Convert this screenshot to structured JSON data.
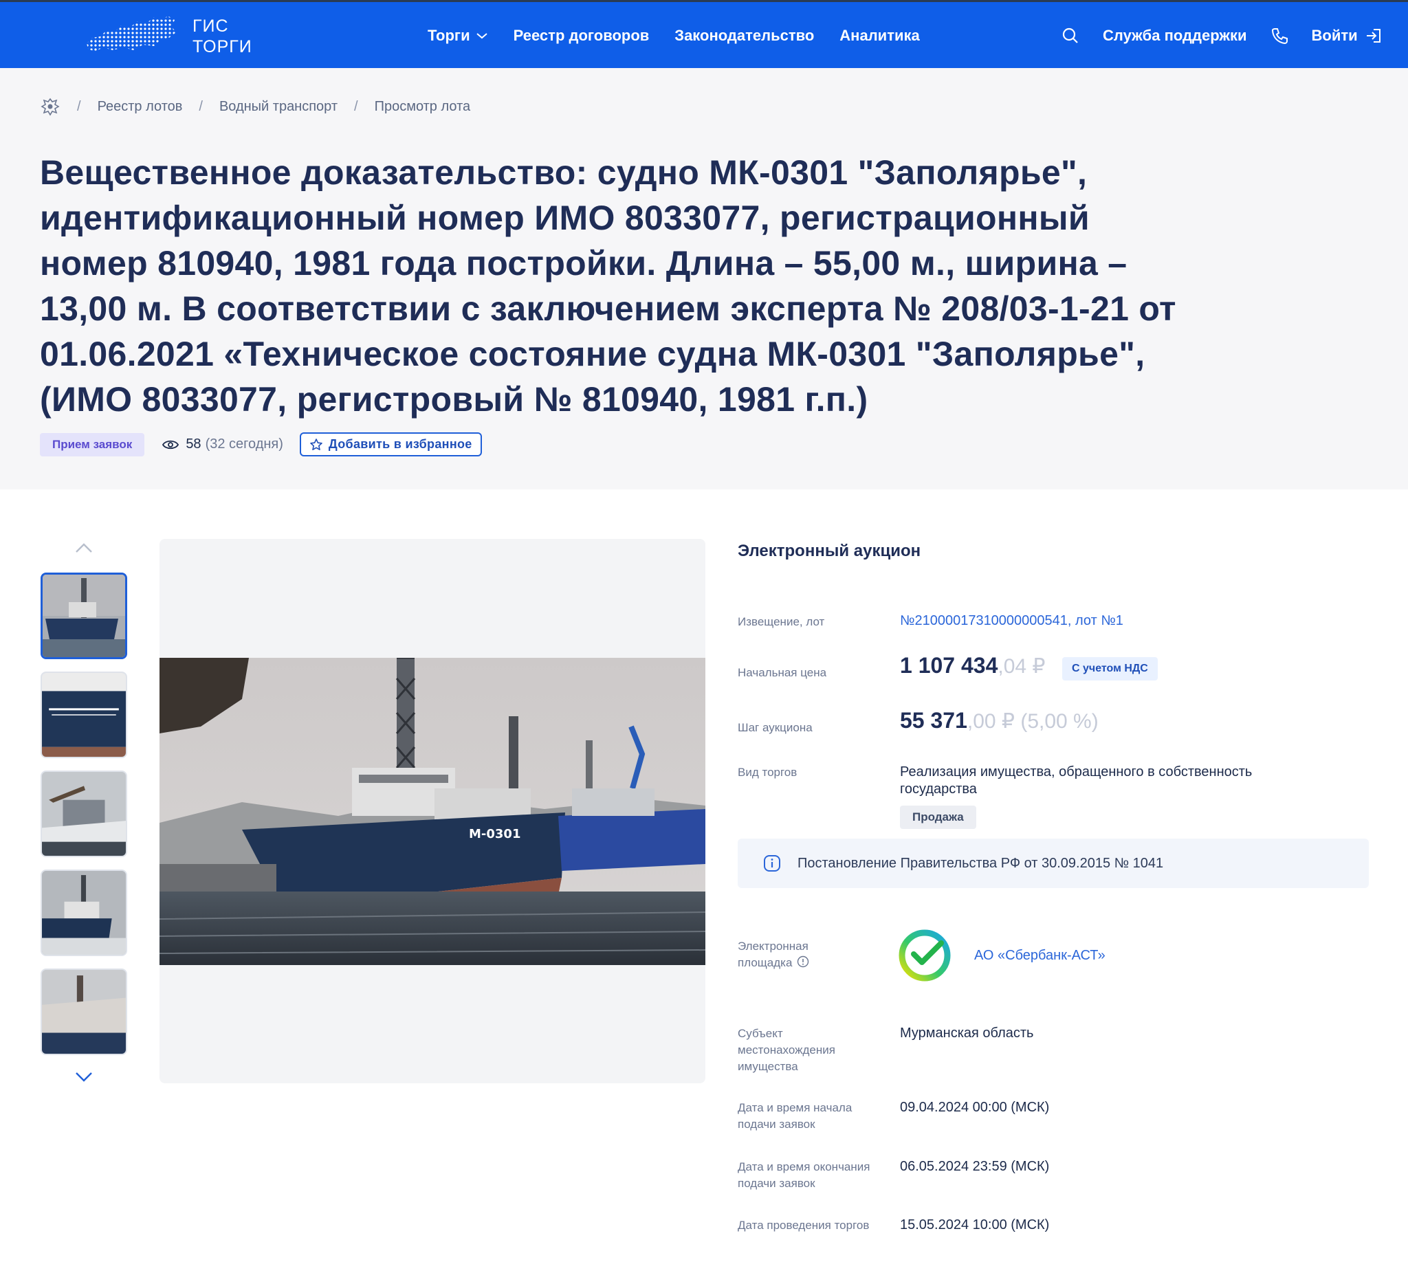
{
  "header": {
    "logo_line1": "ГИС",
    "logo_line2": "ТОРГИ",
    "nav": [
      {
        "label": "Торги"
      },
      {
        "label": "Реестр договоров"
      },
      {
        "label": "Законодательство"
      },
      {
        "label": "Аналитика"
      }
    ],
    "support_label": "Служба поддержки",
    "login_label": "Войти"
  },
  "breadcrumbs": [
    "Реестр лотов",
    "Водный транспорт",
    "Просмотр лота"
  ],
  "lot": {
    "title": "Вещественное доказательство: судно МК-0301 \"Заполярье\", идентификационный номер ИМО 8033077, регистрационный номер 810940, 1981 года постройки. Длина – 55,00 м., ширина – 13,00 м. В соответствии с заключением эксперта № 208/03-1-21 от 01.06.2021 «Техническое состояние судна МК-0301 \"Заполярье\", (ИМО 8033077, регистровый № 810940, 1981 г.п.)",
    "status": "Прием заявок",
    "views": "58",
    "views_today": "(32 сегодня)",
    "favorite_label": "Добавить в избранное"
  },
  "details": {
    "section_title": "Электронный аукцион",
    "notice_label": "Извещение, лот",
    "notice_value": "№21000017310000000541, лот №1",
    "start_price_label": "Начальная цена",
    "start_price_main": "1 107 434",
    "start_price_frac": ",04 ₽",
    "vat_badge": "С учетом НДС",
    "step_label": "Шаг аукциона",
    "step_main": "55 371",
    "step_frac": ",00 ₽ (5,00 %)",
    "trade_type_label": "Вид торгов",
    "trade_type_value": "Реализация имущества, обращенного в собственность государства",
    "sale_badge": "Продажа",
    "note": "Постановление Правительства РФ от 30.09.2015 № 1041",
    "platform_label_1": "Электронная",
    "platform_label_2": "площадка",
    "platform_value": "АО «Сбербанк-АСТ»",
    "region_label": "Субъект местонахождения имущества",
    "region_value": "Мурманская область",
    "start_date_label": "Дата и время начала подачи заявок",
    "start_date_value": "09.04.2024 00:00 (МСК)",
    "end_date_label": "Дата и время окончания подачи заявок",
    "end_date_value": "06.05.2024 23:59 (МСК)",
    "auction_date_label": "Дата проведения торгов",
    "auction_date_value": "15.05.2024 10:00 (МСК)"
  },
  "colors": {
    "header_bg": "#0f5ee8",
    "hero_bg": "#f6f6f8",
    "title": "#1f2d57",
    "link": "#2b66d9",
    "status_badge_bg": "#e4e3fb",
    "status_badge_text": "#5a4bcf"
  },
  "icons": [
    "map-logo-icon",
    "chevron-down-icon",
    "search-icon",
    "phone-icon",
    "login-icon",
    "emblem-icon",
    "eye-icon",
    "star-icon",
    "chevron-up-icon",
    "info-icon",
    "sber-logo-icon",
    "question-icon"
  ]
}
